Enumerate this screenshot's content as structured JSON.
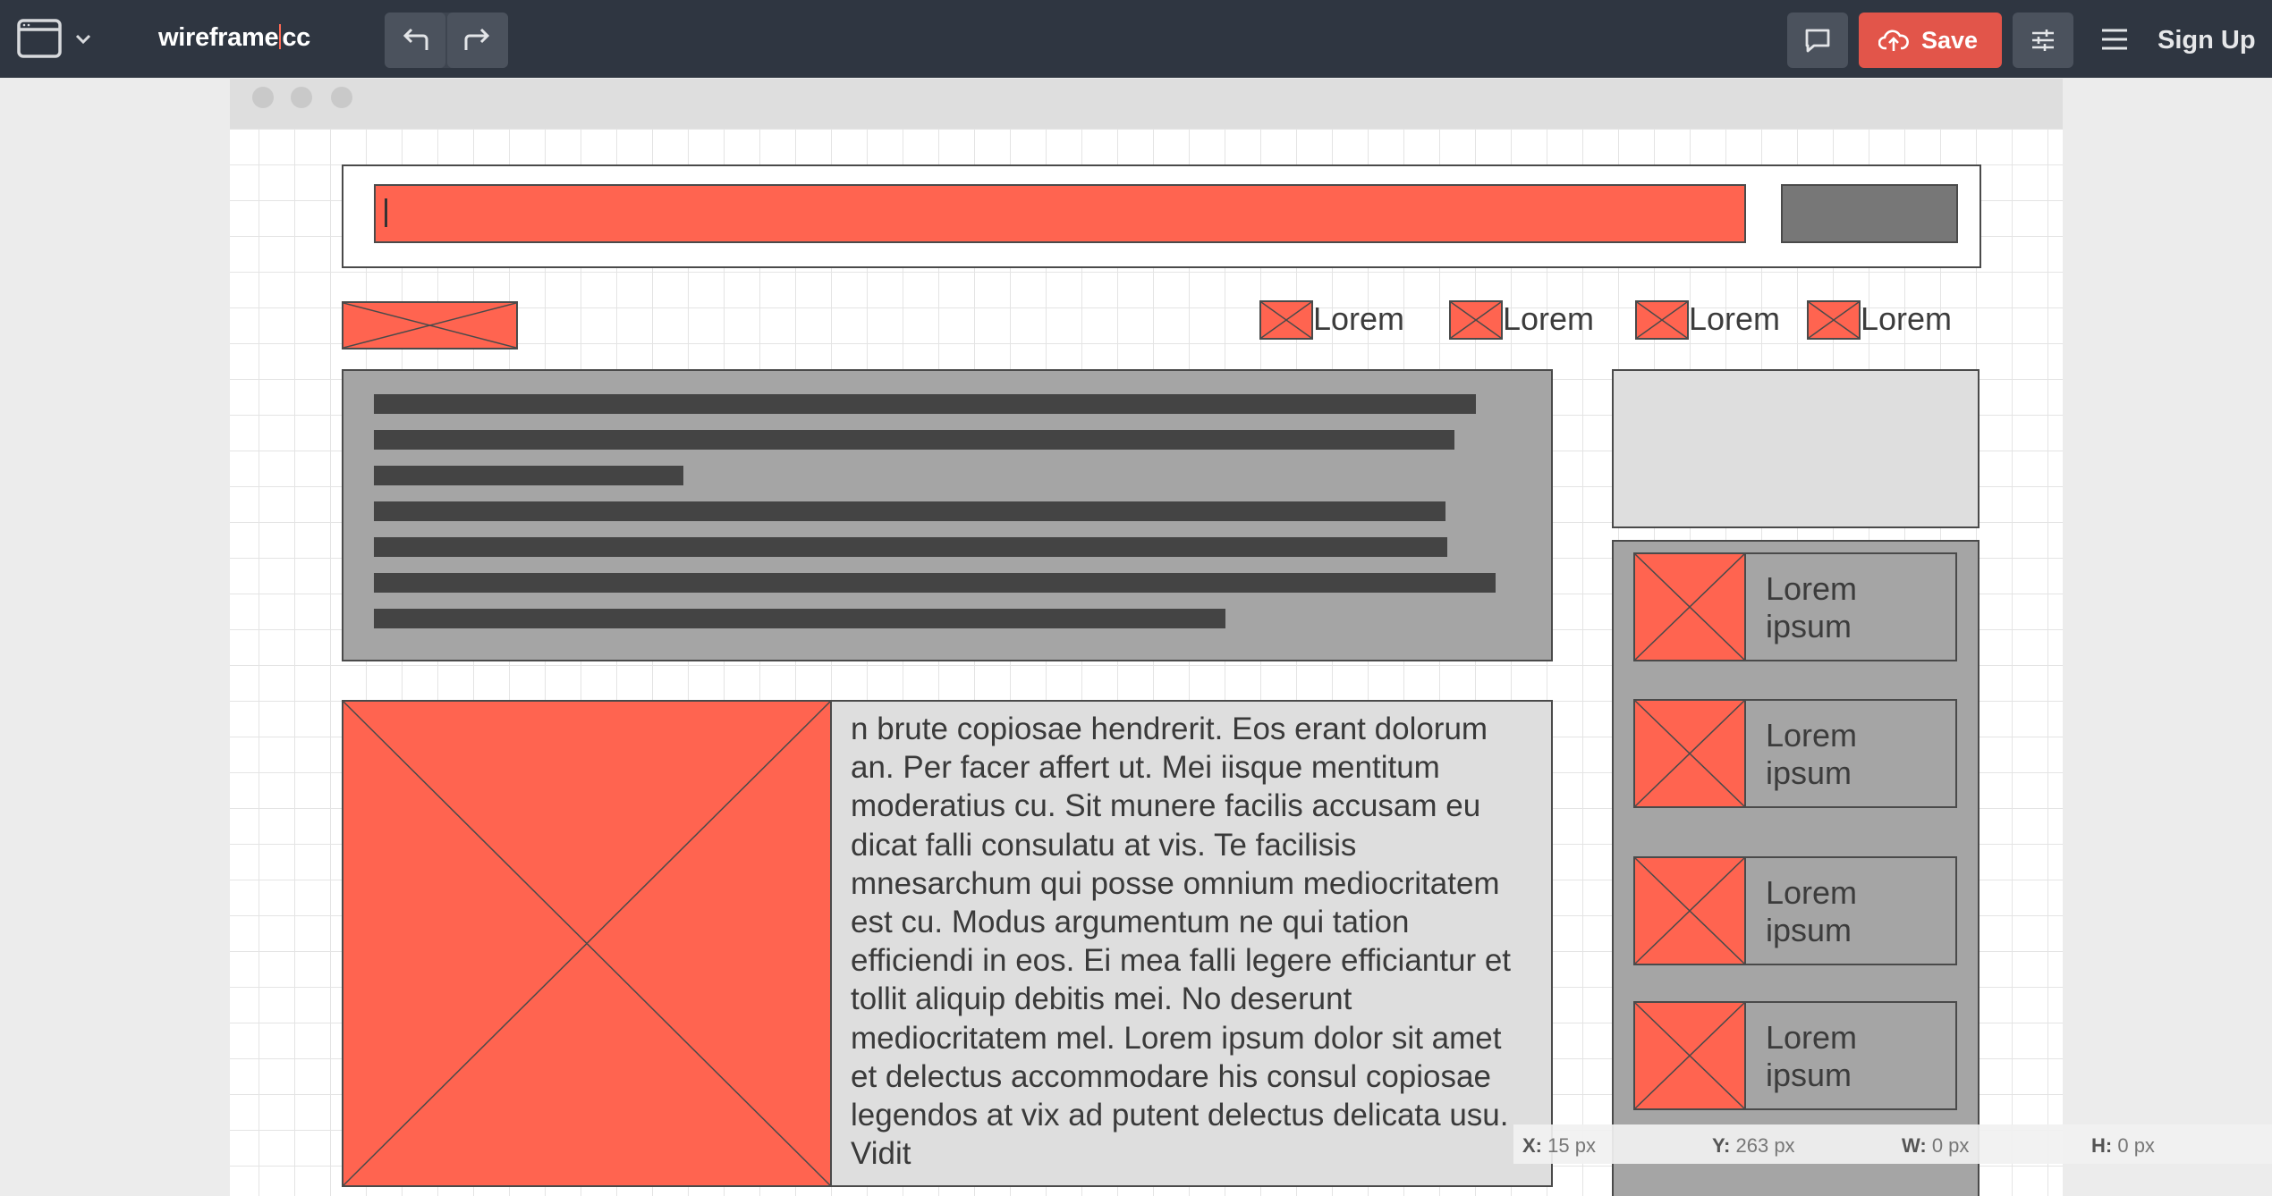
{
  "toolbar": {
    "app_name_left": "wireframe",
    "app_name_right": "cc",
    "save_label": "Save",
    "signup_label": "Sign Up"
  },
  "icons": {
    "window_menu": "window-icon",
    "dropdown": "chevron-down-icon",
    "undo": "undo-icon",
    "redo": "redo-icon",
    "comment": "comment-icon",
    "save": "cloud-upload-icon",
    "settings": "sliders-icon",
    "menu": "hamburger-icon"
  },
  "colors": {
    "toolbar_bg": "#2f3641",
    "accent_save": "#e2554a",
    "placeholder_fill": "#ff6450",
    "panel_gray": "#a5a5a5",
    "panel_light": "#dedede"
  },
  "wireframe": {
    "nav_items": [
      "Lorem",
      "Lorem",
      "Lorem",
      "Lorem"
    ],
    "sidebar_items": [
      "Lorem ipsum",
      "Lorem ipsum",
      "Lorem ipsum",
      "Lorem ipsum"
    ],
    "paragraph": "n brute copiosae hendrerit. Eos erant dolorum an. Per facer affert ut. Mei iisque mentitum moderatius cu. Sit munere facilis accusam eu dicat falli consulatu at vis. Te facilisis mnesarchum qui posse omnium mediocritatem est cu. Modus argumentum ne qui tation efficiendi in eos. Ei mea falli legere efficiantur et tollit aliquip debitis mei. No deserunt mediocritatem mel. Lorem ipsum dolor sit amet et delectus accommodare his consul copiosae legendos at vix ad putent delectus delicata usu. Vidit"
  },
  "status": {
    "x_label": "X:",
    "x_value": "15 px",
    "y_label": "Y:",
    "y_value": "263 px",
    "w_label": "W:",
    "w_value": "0 px",
    "h_label": "H:",
    "h_value": "0 px"
  }
}
